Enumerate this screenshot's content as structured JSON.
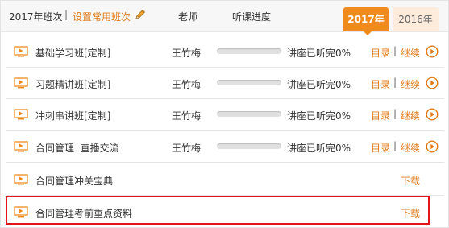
{
  "header": {
    "year_label": "2017年班次",
    "separator": "|",
    "set_common_label": "设置常用班次",
    "teacher_col": "老师",
    "progress_col": "听课进度",
    "tabs": [
      {
        "label": "2017年",
        "active": true
      },
      {
        "label": "2016年",
        "active": false
      }
    ]
  },
  "courses": [
    {
      "name": "基础学习班[定制]",
      "teacher": "王竹梅",
      "progress": 0,
      "status": "讲座已听完0%",
      "dir_label": "目录",
      "sep": "|",
      "continue_label": "继续"
    },
    {
      "name": "习题精讲班[定制]",
      "teacher": "王竹梅",
      "progress": 0,
      "status": "讲座已听完0%",
      "dir_label": "目录",
      "sep": "|",
      "continue_label": "继续"
    },
    {
      "name": "冲刺串讲班[定制]",
      "teacher": "王竹梅",
      "progress": 0,
      "status": "讲座已听完0%",
      "dir_label": "目录",
      "sep": "|",
      "continue_label": "继续"
    },
    {
      "name": "合同管理  直播交流",
      "teacher": "王竹梅",
      "progress": 0,
      "status": "讲座已听完0%",
      "dir_label": "目录",
      "sep": "|",
      "continue_label": "继续"
    }
  ],
  "downloads": [
    {
      "name": "合同管理冲关宝典",
      "download_label": "下载"
    },
    {
      "name": "合同管理考前重点资料",
      "download_label": "下载",
      "highlighted": true
    }
  ],
  "colors": {
    "accent": "#f08a1c",
    "link": "#e07a18",
    "highlight_box": "#e5141a",
    "tab_inactive_bg": "#fdecdc"
  },
  "icons": {
    "row_icon": "video-screen-icon",
    "play_icon": "play-circle-icon",
    "edit_icon": "pencil-icon"
  }
}
